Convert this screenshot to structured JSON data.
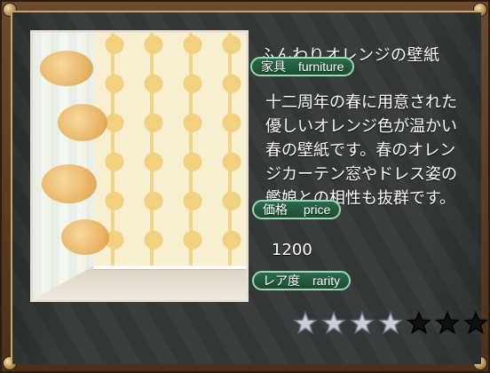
{
  "item": {
    "name": "ふんわりオレンジの壁紙",
    "category_tag": "家具　furniture",
    "description_lines": [
      "十二周年の春に用意された",
      "優しいオレンジ色が温かい",
      "春の壁紙です。春のオレン",
      "ジカーテン窓やドレス姿の",
      "艦娘との相性も抜群です。"
    ],
    "price_tag": "価格　 price",
    "price_value": "1200",
    "rarity_tag": "レア度　rarity",
    "rarity": {
      "filled": 4,
      "total": 7
    }
  },
  "colors": {
    "tag_fill": "#1c4c34",
    "tag_border": "#9ad8b1",
    "star_filled": "#c9ced6",
    "star_empty": "#111111"
  }
}
